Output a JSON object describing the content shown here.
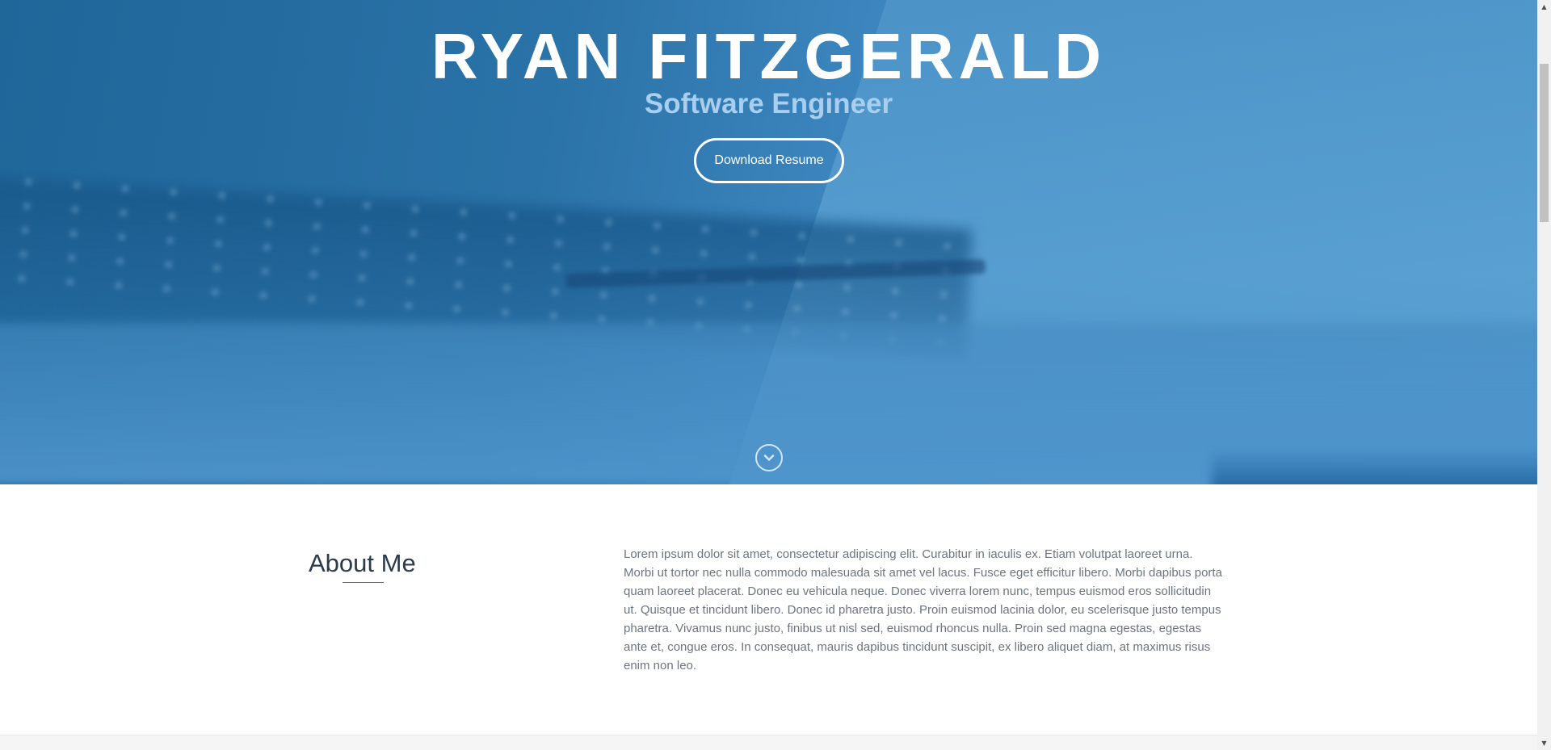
{
  "hero": {
    "name": "RYAN FITZGERALD",
    "title": "Software Engineer",
    "resume_button": "Download Resume",
    "scroll_icon": "chevron-down-circle-icon"
  },
  "about": {
    "heading": "About Me",
    "body": "Lorem ipsum dolor sit amet, consectetur adipiscing elit. Curabitur in iaculis ex. Etiam volutpat laoreet urna. Morbi ut tortor nec nulla commodo malesuada sit amet vel lacus. Fusce eget efficitur libero. Morbi dapibus porta quam laoreet placerat. Donec eu vehicula neque. Donec viverra lorem nunc, tempus euismod eros sollicitudin ut. Quisque et tincidunt libero. Donec id pharetra justo. Proin euismod lacinia dolor, eu scelerisque justo tempus pharetra. Vivamus nunc justo, finibus ut nisl sed, euismod rhoncus nulla. Proin sed magna egestas, egestas ante et, congue eros. In consequat, mauris dapibus tincidunt suscipit, ex libero aliquet diam, at maximus risus enim non leo."
  },
  "colors": {
    "hero_blue": "#2a73a8",
    "accent": "#2b7bbb",
    "heading_text": "#2b3a4c",
    "body_text": "#6c7480"
  },
  "scrollbar": {
    "up_icon": "scroll-up-arrow-icon",
    "down_icon": "scroll-down-arrow-icon"
  }
}
